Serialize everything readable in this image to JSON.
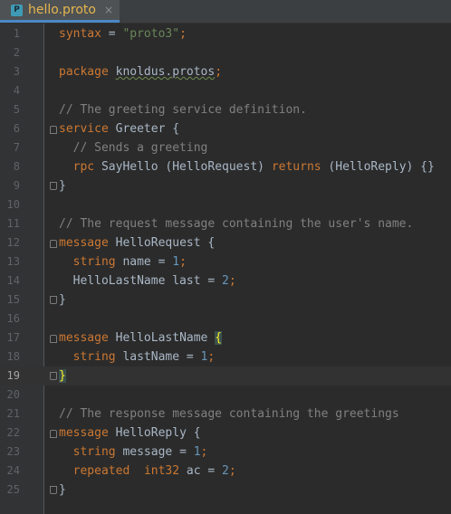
{
  "tab": {
    "label": "hello.proto",
    "icon": "P",
    "close": "×"
  },
  "lines": [
    {
      "n": "1",
      "tokens": [
        {
          "t": "syntax",
          "c": "kw"
        },
        {
          "t": " = ",
          "c": ""
        },
        {
          "t": "\"proto3\"",
          "c": "str"
        },
        {
          "t": ";",
          "c": "kw"
        }
      ]
    },
    {
      "n": "2",
      "tokens": []
    },
    {
      "n": "3",
      "tokens": [
        {
          "t": "package",
          "c": "kw"
        },
        {
          "t": " ",
          "c": ""
        },
        {
          "t": "knoldus.protos",
          "c": "pkg"
        },
        {
          "t": ";",
          "c": "kw"
        }
      ]
    },
    {
      "n": "4",
      "tokens": []
    },
    {
      "n": "5",
      "tokens": [
        {
          "t": "// The greeting service definition.",
          "c": "cmt"
        }
      ]
    },
    {
      "n": "6",
      "fold": "open",
      "tokens": [
        {
          "t": "service",
          "c": "kw"
        },
        {
          "t": " Greeter {",
          "c": ""
        }
      ]
    },
    {
      "n": "7",
      "tokens": [
        {
          "t": "  // Sends a greeting",
          "c": "cmt"
        }
      ]
    },
    {
      "n": "8",
      "tokens": [
        {
          "t": "  ",
          "c": ""
        },
        {
          "t": "rpc",
          "c": "kw"
        },
        {
          "t": " SayHello (HelloRequest) ",
          "c": ""
        },
        {
          "t": "returns",
          "c": "kw"
        },
        {
          "t": " (HelloReply) {}",
          "c": ""
        }
      ]
    },
    {
      "n": "9",
      "fold": "close",
      "tokens": [
        {
          "t": "}",
          "c": ""
        }
      ]
    },
    {
      "n": "10",
      "tokens": []
    },
    {
      "n": "11",
      "tokens": [
        {
          "t": "// The request message containing the user's name.",
          "c": "cmt"
        }
      ]
    },
    {
      "n": "12",
      "fold": "open",
      "tokens": [
        {
          "t": "message",
          "c": "kw"
        },
        {
          "t": " HelloRequest {",
          "c": ""
        }
      ]
    },
    {
      "n": "13",
      "tokens": [
        {
          "t": "  ",
          "c": ""
        },
        {
          "t": "string",
          "c": "kw"
        },
        {
          "t": " name = ",
          "c": ""
        },
        {
          "t": "1",
          "c": "num"
        },
        {
          "t": ";",
          "c": "kw"
        }
      ]
    },
    {
      "n": "14",
      "tokens": [
        {
          "t": "  HelloLastName last = ",
          "c": ""
        },
        {
          "t": "2",
          "c": "num"
        },
        {
          "t": ";",
          "c": "kw"
        }
      ]
    },
    {
      "n": "15",
      "fold": "close",
      "tokens": [
        {
          "t": "}",
          "c": ""
        }
      ]
    },
    {
      "n": "16",
      "tokens": []
    },
    {
      "n": "17",
      "fold": "open",
      "tokens": [
        {
          "t": "message",
          "c": "kw"
        },
        {
          "t": " HelloLastName ",
          "c": ""
        },
        {
          "t": "{",
          "c": "brace-hl"
        }
      ]
    },
    {
      "n": "18",
      "tokens": [
        {
          "t": "  ",
          "c": ""
        },
        {
          "t": "string",
          "c": "kw"
        },
        {
          "t": " lastName = ",
          "c": ""
        },
        {
          "t": "1",
          "c": "num"
        },
        {
          "t": ";",
          "c": "kw"
        }
      ]
    },
    {
      "n": "19",
      "fold": "close",
      "current": true,
      "tokens": [
        {
          "t": "}",
          "c": "caret-block"
        }
      ]
    },
    {
      "n": "20",
      "tokens": []
    },
    {
      "n": "21",
      "tokens": [
        {
          "t": "// The response message containing the greetings",
          "c": "cmt"
        }
      ]
    },
    {
      "n": "22",
      "fold": "open",
      "tokens": [
        {
          "t": "message",
          "c": "kw"
        },
        {
          "t": " HelloReply {",
          "c": ""
        }
      ]
    },
    {
      "n": "23",
      "tokens": [
        {
          "t": "  ",
          "c": ""
        },
        {
          "t": "string",
          "c": "kw"
        },
        {
          "t": " message = ",
          "c": ""
        },
        {
          "t": "1",
          "c": "num"
        },
        {
          "t": ";",
          "c": "kw"
        }
      ]
    },
    {
      "n": "24",
      "tokens": [
        {
          "t": "  ",
          "c": ""
        },
        {
          "t": "repeated",
          "c": "kw"
        },
        {
          "t": "  ",
          "c": ""
        },
        {
          "t": "int32",
          "c": "kw"
        },
        {
          "t": " ac = ",
          "c": ""
        },
        {
          "t": "2",
          "c": "num"
        },
        {
          "t": ";",
          "c": "kw"
        }
      ]
    },
    {
      "n": "25",
      "fold": "close",
      "tokens": [
        {
          "t": "}",
          "c": ""
        }
      ]
    }
  ],
  "colors": {
    "background": "#2b2b2b",
    "keyword": "#cc7832",
    "string": "#6a8759",
    "number": "#6897bb",
    "comment": "#808080",
    "text": "#a9b7c6",
    "tab_label": "#e6b54e"
  }
}
